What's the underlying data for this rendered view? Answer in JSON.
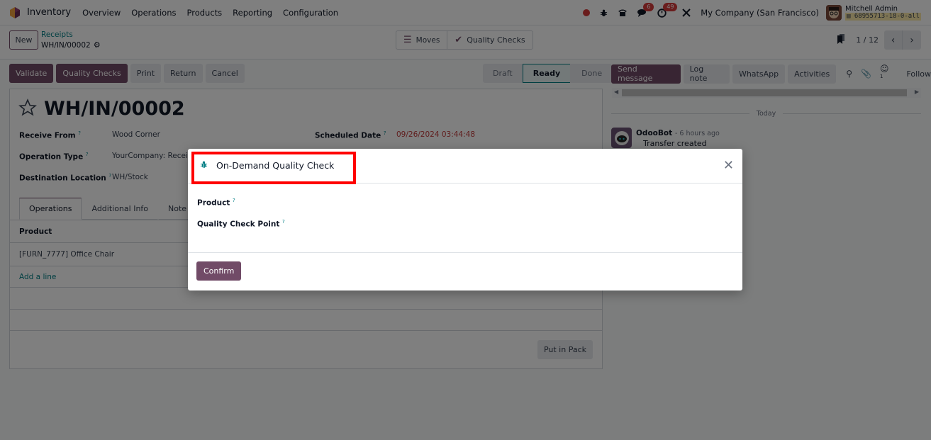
{
  "navbar": {
    "app_name": "Inventory",
    "menu": [
      "Overview",
      "Operations",
      "Products",
      "Reporting",
      "Configuration"
    ],
    "messages_badge": "6",
    "activities_badge": "49",
    "company": "My Company (San Francisco)",
    "user_name": "Mitchell Admin",
    "db_name": "68955713-18-0-all"
  },
  "control_panel": {
    "new_label": "New",
    "breadcrumb_parent": "Receipts",
    "breadcrumb_current": "WH/IN/00002",
    "smart_buttons": [
      "Moves",
      "Quality Checks"
    ],
    "pager": "1 / 12"
  },
  "actions": {
    "buttons": [
      "Validate",
      "Quality Checks",
      "Print",
      "Return",
      "Cancel"
    ],
    "status_steps": [
      "Draft",
      "Ready",
      "Done"
    ],
    "active_status": "Ready"
  },
  "chatter": {
    "buttons": [
      "Send message",
      "Log note",
      "WhatsApp",
      "Activities"
    ],
    "followers_count": "1",
    "follow_label": "Follow",
    "date_separator": "Today",
    "messages": [
      {
        "author": "OdooBot",
        "time": "- 6 hours ago",
        "body": "Transfer created"
      }
    ]
  },
  "form": {
    "title": "WH/IN/00002",
    "fields": {
      "receive_from_label": "Receive From",
      "receive_from": "Wood Corner",
      "operation_type_label": "Operation Type",
      "operation_type": "YourCompany: Receipts",
      "destination_label": "Destination Location",
      "destination": "WH/Stock",
      "scheduled_date_label": "Scheduled Date",
      "scheduled_date": "09/26/2024 03:44:48"
    },
    "help_mark": "?",
    "tabs": [
      "Operations",
      "Additional Info",
      "Note"
    ],
    "list_header": "Product",
    "rows": [
      "[FURN_7777] Office Chair"
    ],
    "add_line": "Add a line",
    "put_in_pack": "Put in Pack"
  },
  "modal": {
    "title": "On-Demand Quality Check",
    "product_label": "Product",
    "check_point_label": "Quality Check Point",
    "confirm_label": "Confirm",
    "close_icon": "close-icon"
  },
  "colors": {
    "brand": "#714b67",
    "accent": "#017e84",
    "danger": "#d43a3a",
    "highlight": "#ff0000"
  }
}
